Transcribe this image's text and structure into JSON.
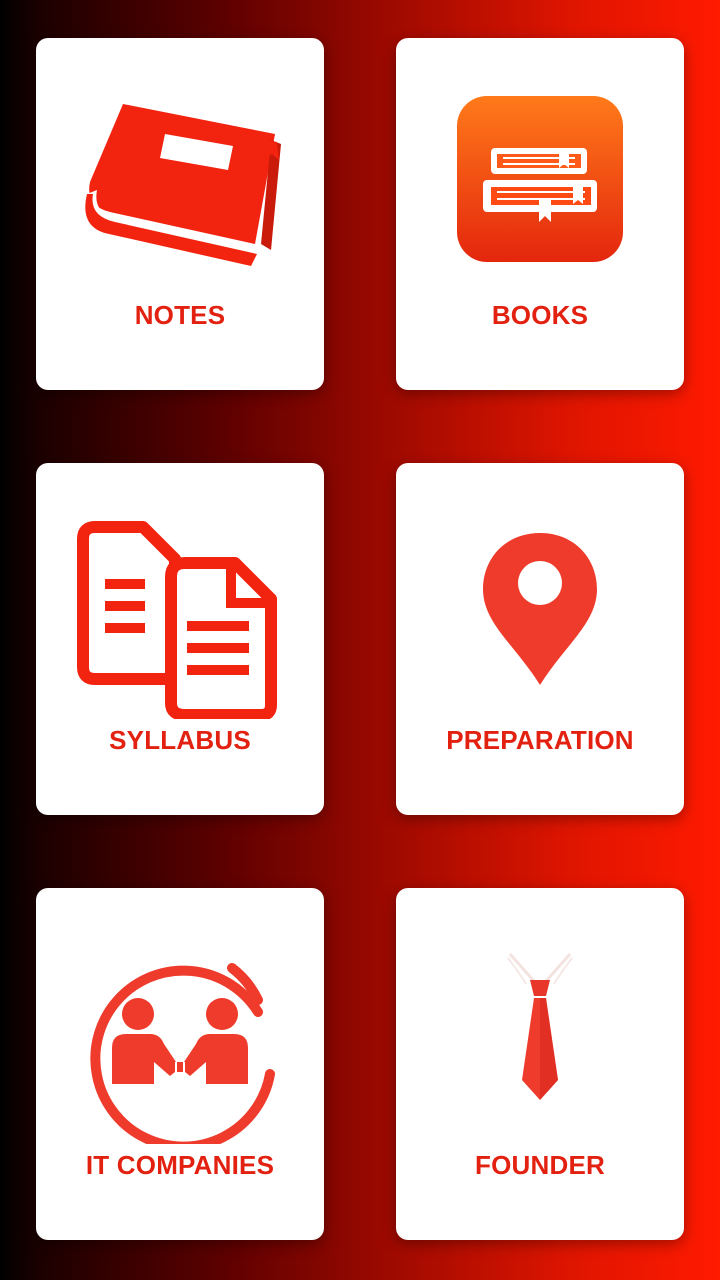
{
  "menu": {
    "items": [
      {
        "label": "NOTES",
        "icon": "notebook-icon"
      },
      {
        "label": "BOOKS",
        "icon": "books-stack-icon"
      },
      {
        "label": "SYLLABUS",
        "icon": "documents-copy-icon"
      },
      {
        "label": "PREPARATION",
        "icon": "location-pin-icon"
      },
      {
        "label": "IT COMPANIES",
        "icon": "handshake-icon"
      },
      {
        "label": "FOUNDER",
        "icon": "necktie-icon"
      }
    ]
  },
  "colors": {
    "accent": "#e32110",
    "card": "#ffffff",
    "gradient_start": "#000000",
    "gradient_end": "#ff1a00"
  }
}
